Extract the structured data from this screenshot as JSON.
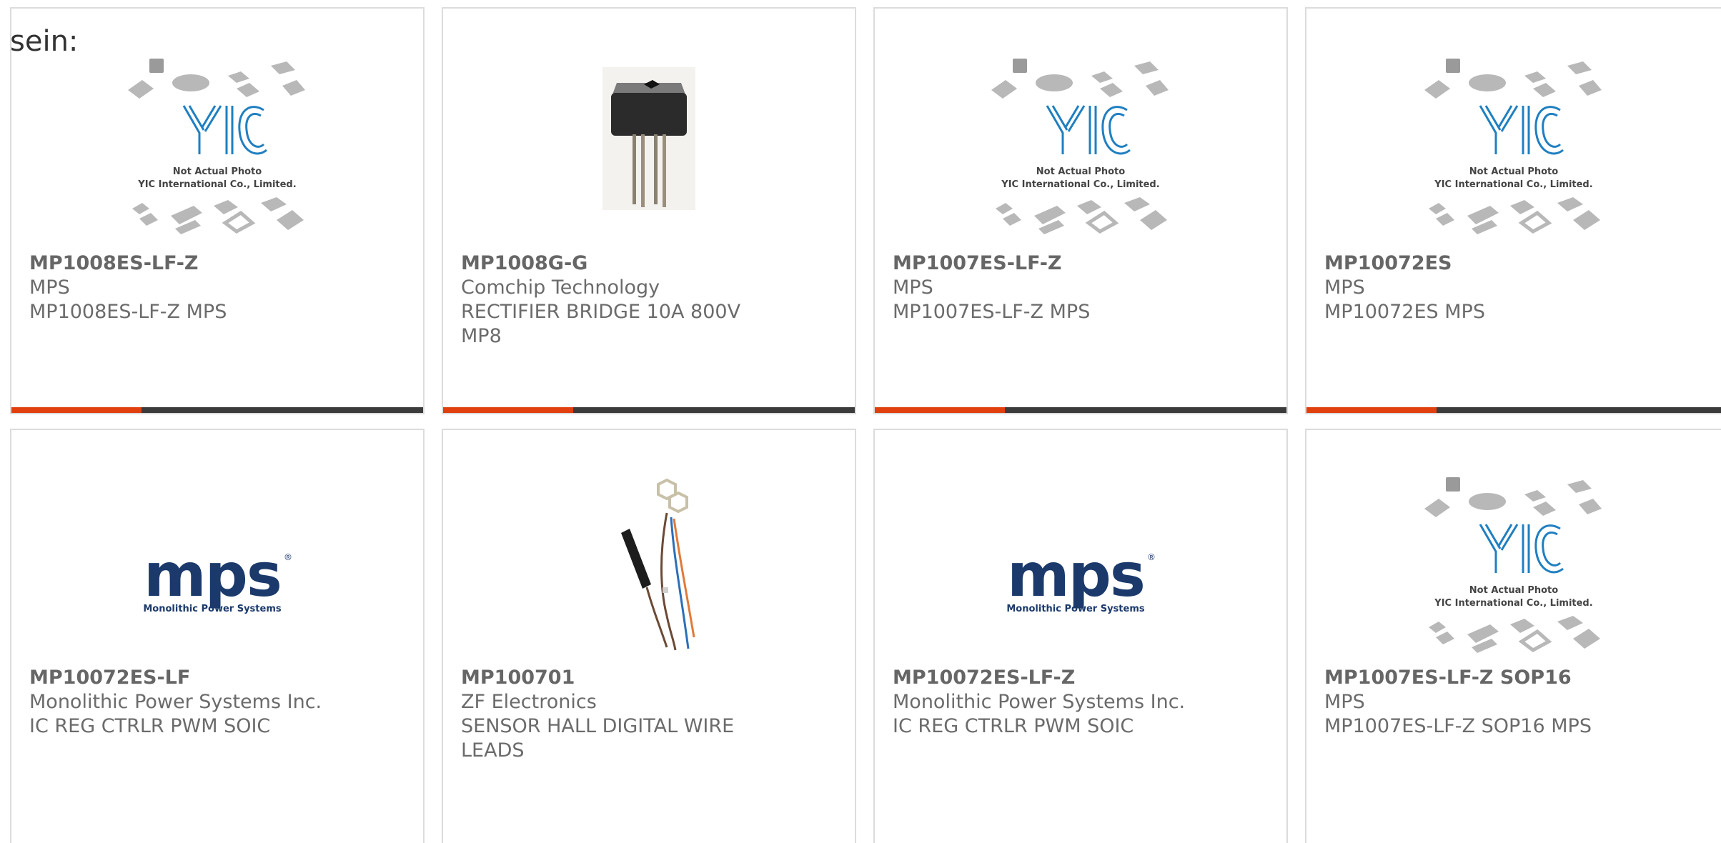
{
  "intro": "sein:",
  "colors": {
    "accent": "#e1400e",
    "bar": "#3b3b3b",
    "mps_blue": "#1b3a6b",
    "yic_blue": "#1f7fc1"
  },
  "placeholder_image": {
    "brand": "YIC",
    "line1": "Not Actual Photo",
    "line2": "YIC International Co., Limited."
  },
  "mps_logo": {
    "wordmark": "mps",
    "registered": "®",
    "tagline": "Monolithic Power Systems"
  },
  "products": [
    {
      "part": "MP1008ES-LF-Z",
      "manufacturer": "MPS",
      "description": "MP1008ES-LF-Z MPS",
      "image": "yic-placeholder"
    },
    {
      "part": "MP1008G-G",
      "manufacturer": "Comchip Technology",
      "description": "RECTIFIER BRIDGE 10A 800V MP8",
      "image": "bridge-rectifier"
    },
    {
      "part": "MP1007ES-LF-Z",
      "manufacturer": "MPS",
      "description": "MP1007ES-LF-Z MPS",
      "image": "yic-placeholder"
    },
    {
      "part": "MP10072ES",
      "manufacturer": "MPS",
      "description": "MP10072ES MPS",
      "image": "yic-placeholder"
    },
    {
      "part": "MP10072ES-LF",
      "manufacturer": "Monolithic Power Systems Inc.",
      "description": "IC REG CTRLR PWM SOIC",
      "image": "mps-logo"
    },
    {
      "part": "MP100701",
      "manufacturer": "ZF Electronics",
      "description": "SENSOR HALL DIGITAL WIRE LEADS",
      "image": "hall-sensor"
    },
    {
      "part": "MP10072ES-LF-Z",
      "manufacturer": "Monolithic Power Systems Inc.",
      "description": "IC REG CTRLR PWM SOIC",
      "image": "mps-logo"
    },
    {
      "part": "MP1007ES-LF-Z SOP16",
      "manufacturer": "MPS",
      "description": "MP1007ES-LF-Z SOP16 MPS",
      "image": "yic-placeholder"
    }
  ]
}
